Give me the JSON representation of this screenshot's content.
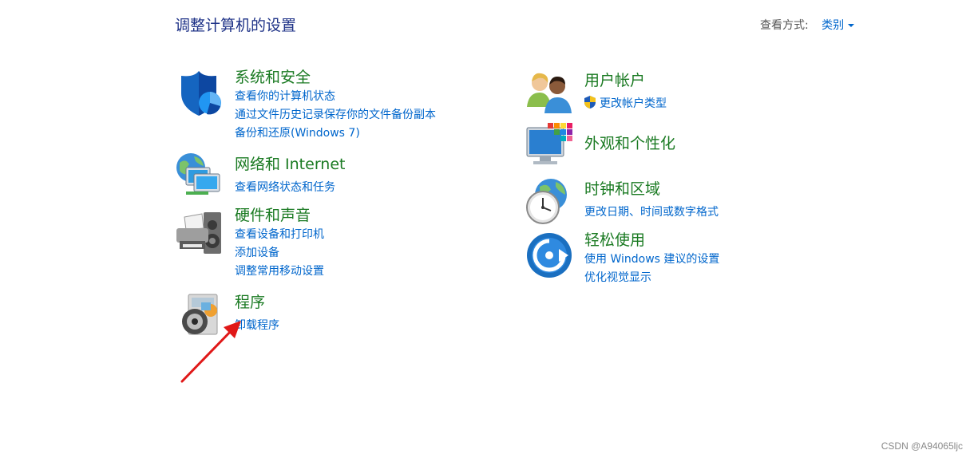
{
  "header": {
    "title": "调整计算机的设置",
    "view_by_label": "查看方式:",
    "view_by_value": "类别"
  },
  "categories": [
    {
      "title": "系统和安全",
      "icon": "security-shield-icon",
      "links": [
        "查看你的计算机状态",
        "通过文件历史记录保存你的文件备份副本",
        "备份和还原(Windows 7)"
      ]
    },
    {
      "title": "网络和 Internet",
      "icon": "network-globe-icon",
      "links": [
        "查看网络状态和任务"
      ]
    },
    {
      "title": "硬件和声音",
      "icon": "printer-speaker-icon",
      "links": [
        "查看设备和打印机",
        "添加设备",
        "调整常用移动设置"
      ]
    },
    {
      "title": "程序",
      "icon": "programs-disc-icon",
      "links": [
        "卸载程序"
      ]
    },
    {
      "title": "用户帐户",
      "icon": "user-accounts-icon",
      "links": [
        "更改帐户类型"
      ]
    },
    {
      "title": "外观和个性化",
      "icon": "monitor-palette-icon",
      "links": []
    },
    {
      "title": "时钟和区域",
      "icon": "clock-globe-icon",
      "links": [
        "更改日期、时间或数字格式"
      ]
    },
    {
      "title": "轻松使用",
      "icon": "ease-of-access-icon",
      "links": [
        "使用 Windows 建议的设置",
        "优化视觉显示"
      ]
    }
  ],
  "watermark": "CSDN @A94065ljc",
  "colors": {
    "title": "#1e3287",
    "category": "#1a7a22",
    "link": "#0066cc",
    "arrow": "#e01818"
  }
}
